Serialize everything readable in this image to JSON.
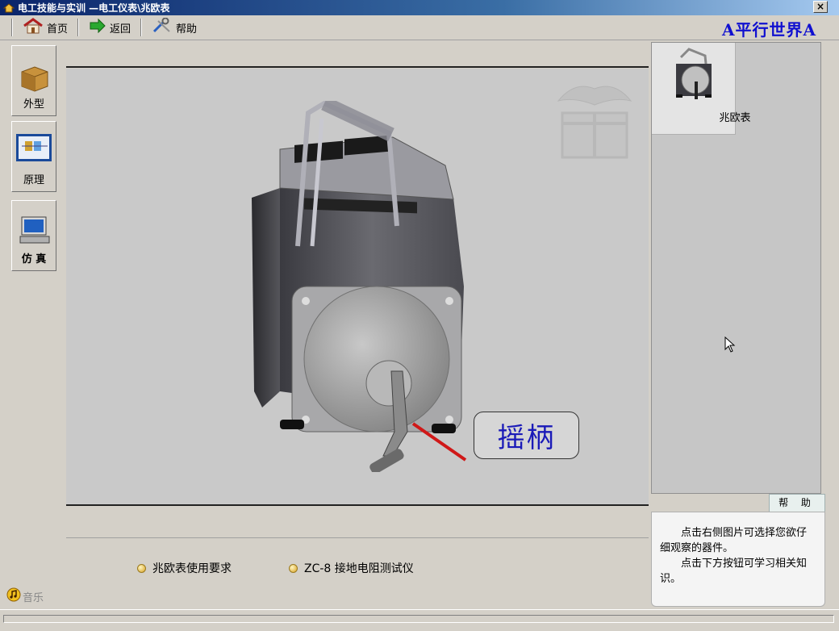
{
  "window": {
    "title": "电工技能与实训 —电工仪表\\兆欧表",
    "close_label": "×"
  },
  "toolbar": {
    "home_label": "首页",
    "back_label": "返回",
    "help_label": "帮助",
    "brand": "A平行世界A"
  },
  "sidebar": {
    "items": [
      {
        "label": "外型",
        "icon": "box-icon"
      },
      {
        "label": "原理",
        "icon": "schematic-icon"
      },
      {
        "label": "仿 真",
        "icon": "computer-icon"
      }
    ],
    "music_label": "音乐"
  },
  "viewer": {
    "callout_label": "摇柄",
    "links": [
      {
        "label": "兆欧表使用要求"
      },
      {
        "label": "ZC-8 接地电阻测试仪"
      }
    ]
  },
  "gallery": {
    "items": [
      {
        "label": "兆欧表"
      }
    ]
  },
  "help": {
    "tab_label": "帮 助",
    "paragraphs": [
      "点击右侧图片可选择您欲仔细观察的器件。",
      "点击下方按钮可学习相关知识。"
    ]
  }
}
